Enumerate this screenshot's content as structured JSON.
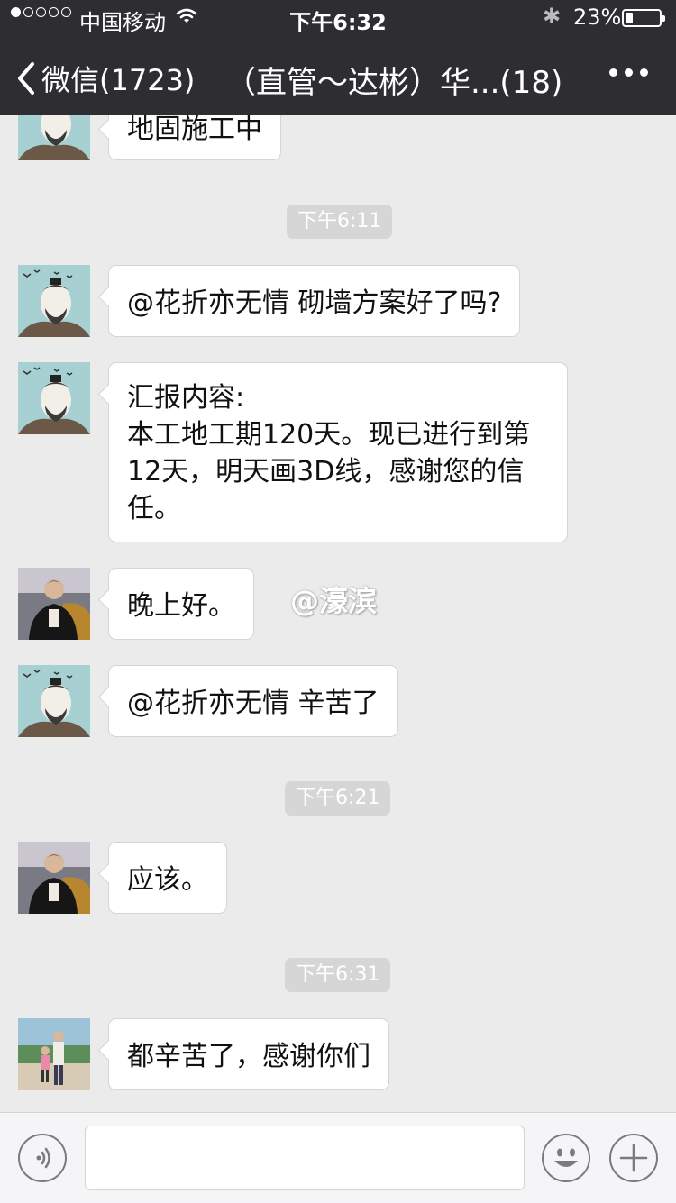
{
  "status_bar": {
    "carrier": "中国移动",
    "time": "下午6:32",
    "battery_percent": "23%",
    "battery_level": 0.23
  },
  "nav": {
    "back_label": "微信(1723)",
    "title": "（直管～达彬）华...(18)"
  },
  "messages": [
    {
      "type": "text",
      "sender_avatar": "sketch-man-avatar",
      "text": "地固施工中"
    },
    {
      "type": "time",
      "text": "下午6:11"
    },
    {
      "type": "text",
      "sender_avatar": "sketch-man-avatar",
      "text": "@花折亦无情 砌墙方案好了吗?"
    },
    {
      "type": "text",
      "sender_avatar": "sketch-man-avatar",
      "lines": [
        "汇报内容:",
        "本工地工期120天。现已进行到第",
        "12天，明天画3D线，感谢您的信",
        "任。"
      ]
    },
    {
      "type": "text",
      "sender_avatar": "photo-man-avatar",
      "text": "晚上好。"
    },
    {
      "type": "text",
      "sender_avatar": "sketch-man-avatar",
      "text": "@花折亦无情 辛苦了"
    },
    {
      "type": "time",
      "text": "下午6:21"
    },
    {
      "type": "text",
      "sender_avatar": "photo-man-avatar",
      "text": "应该。"
    },
    {
      "type": "time",
      "text": "下午6:31"
    },
    {
      "type": "text",
      "sender_avatar": "family-photo-avatar",
      "text": "都辛苦了，感谢你们"
    }
  ],
  "watermark": "@濠滨",
  "input": {
    "voice_icon": "voice-icon",
    "emoji_icon": "emoji-icon",
    "plus_icon": "plus-icon"
  }
}
